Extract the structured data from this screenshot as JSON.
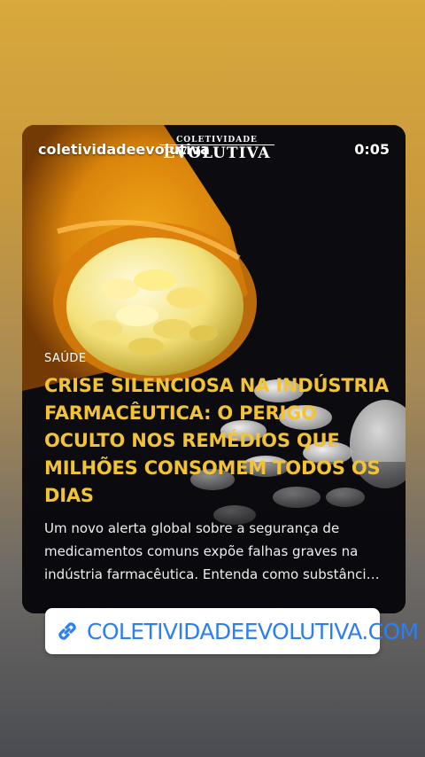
{
  "story": {
    "username": "coletividadeevolutiva",
    "timer": "0:05",
    "logo_small": "COLETIVIDADE",
    "logo_big": "EVOLUTIVA"
  },
  "article": {
    "category": "SAÚDE",
    "headline": "CRISE SILENCIOSA NA INDÚSTRIA FARMACÊUTICA: O PERIGO OCULTO NOS REMÉDIOS QUE MILHÕES CONSOMEM TODOS OS DIAS",
    "summary": "Um novo alerta global sobre a segurança de medicamentos comuns expõe falhas graves na indústria farmacêutica. Entenda como substâncias presentes em remédios do dia a dia podem afetar sua saúde."
  },
  "link_sticker": {
    "icon": "link-icon",
    "text": "COLETIVIDADEEVOLUTIVA.COM"
  },
  "colors": {
    "headline": "#f2c335",
    "link": "#2d7ff0",
    "background_top": "#d8a93c",
    "background_bottom": "#4a4c52"
  }
}
